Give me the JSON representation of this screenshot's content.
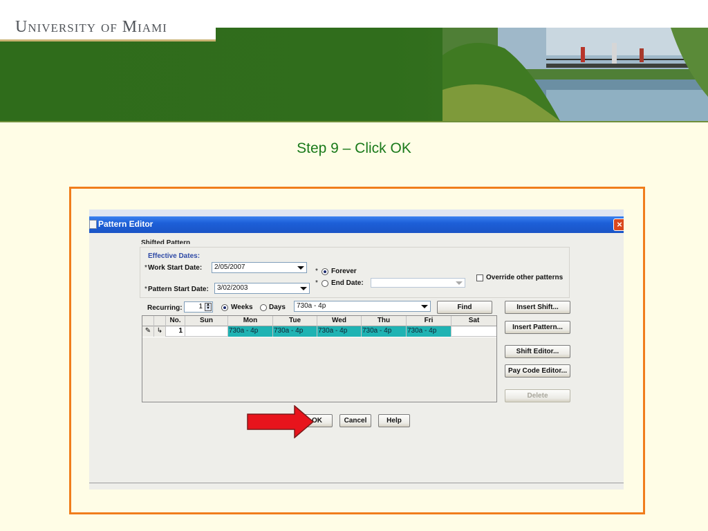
{
  "header": {
    "logo_text": "University of Miami"
  },
  "slide": {
    "step_title": "Step 9 – Click OK"
  },
  "window": {
    "title": "Pattern Editor",
    "close_glyph": "×",
    "cut_label": "Shifted Pattern"
  },
  "effective_dates": {
    "title": "Effective Dates:",
    "work_start_label": "Work Start Date:",
    "work_start_value": "2/05/2007",
    "pattern_start_label": "Pattern Start Date:",
    "pattern_start_value": "3/02/2003",
    "required_mark": "*",
    "forever_label": "Forever",
    "forever_selected": true,
    "end_date_label": "End Date:",
    "end_date_value": "",
    "override_label": "Override other patterns",
    "override_checked": false
  },
  "recurring": {
    "label": "Recurring:",
    "value": "1",
    "weeks_label": "Weeks",
    "days_label": "Days",
    "unit_selected": "Weeks",
    "shift_value": "730a - 4p",
    "find_label": "Find"
  },
  "side_buttons": {
    "insert_shift": "Insert Shift...",
    "insert_pattern": "Insert Pattern...",
    "shift_editor": "Shift Editor...",
    "pay_code_editor": "Pay Code Editor...",
    "delete": "Delete"
  },
  "grid": {
    "columns": [
      "No.",
      "Sun",
      "Mon",
      "Tue",
      "Wed",
      "Thu",
      "Fri",
      "Sat"
    ],
    "rows": [
      {
        "no": "1",
        "sun": "",
        "mon": "730a - 4p",
        "tue": "730a - 4p",
        "wed": "730a - 4p",
        "thu": "730a - 4p",
        "fri": "730a - 4p",
        "sat": ""
      }
    ]
  },
  "dialog_buttons": {
    "ok": "OK",
    "cancel": "Cancel",
    "help": "Help"
  },
  "colors": {
    "frame": "#f07d1c",
    "title_green": "#1a7a1a",
    "header_green": "#306d1c",
    "titlebar_blue": "#1d5fd8",
    "shift_cell": "#1fb3b3",
    "arrow_red": "#e8141c"
  }
}
